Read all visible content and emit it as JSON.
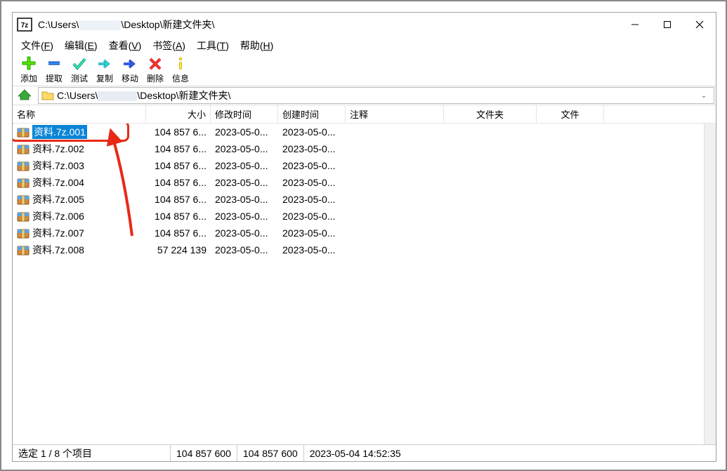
{
  "window": {
    "title_prefix": "C:\\Users\\",
    "title_suffix": "\\Desktop\\新建文件夹\\"
  },
  "menu": {
    "file": {
      "label": "文件",
      "key": "F"
    },
    "edit": {
      "label": "编辑",
      "key": "E"
    },
    "view": {
      "label": "查看",
      "key": "V"
    },
    "bookmark": {
      "label": "书签",
      "key": "A"
    },
    "tools": {
      "label": "工具",
      "key": "T"
    },
    "help": {
      "label": "帮助",
      "key": "H"
    }
  },
  "toolbar": {
    "add": "添加",
    "extract": "提取",
    "test": "测试",
    "copy": "复制",
    "move": "移动",
    "delete": "删除",
    "info": "信息"
  },
  "path": {
    "prefix": "C:\\Users\\",
    "suffix": "\\Desktop\\新建文件夹\\"
  },
  "columns": {
    "name": "名称",
    "size": "大小",
    "modified": "修改时间",
    "created": "创建时间",
    "comment": "注释",
    "folder": "文件夹",
    "file": "文件"
  },
  "files": [
    {
      "name": "资料.7z.001",
      "size": "104 857 6...",
      "modified": "2023-05-0...",
      "created": "2023-05-0...",
      "selected": true
    },
    {
      "name": "资料.7z.002",
      "size": "104 857 6...",
      "modified": "2023-05-0...",
      "created": "2023-05-0..."
    },
    {
      "name": "资料.7z.003",
      "size": "104 857 6...",
      "modified": "2023-05-0...",
      "created": "2023-05-0..."
    },
    {
      "name": "资料.7z.004",
      "size": "104 857 6...",
      "modified": "2023-05-0...",
      "created": "2023-05-0..."
    },
    {
      "name": "资料.7z.005",
      "size": "104 857 6...",
      "modified": "2023-05-0...",
      "created": "2023-05-0..."
    },
    {
      "name": "资料.7z.006",
      "size": "104 857 6...",
      "modified": "2023-05-0...",
      "created": "2023-05-0..."
    },
    {
      "name": "资料.7z.007",
      "size": "104 857 6...",
      "modified": "2023-05-0...",
      "created": "2023-05-0..."
    },
    {
      "name": "资料.7z.008",
      "size": "57 224 139",
      "modified": "2023-05-0...",
      "created": "2023-05-0..."
    }
  ],
  "status": {
    "selection": "选定 1 / 8 个项目",
    "size1": "104 857 600",
    "size2": "104 857 600",
    "datetime": "2023-05-04 14:52:35"
  },
  "icons": {
    "app": "7z-icon",
    "folder": "folder-icon",
    "part": "archive-part-icon"
  }
}
